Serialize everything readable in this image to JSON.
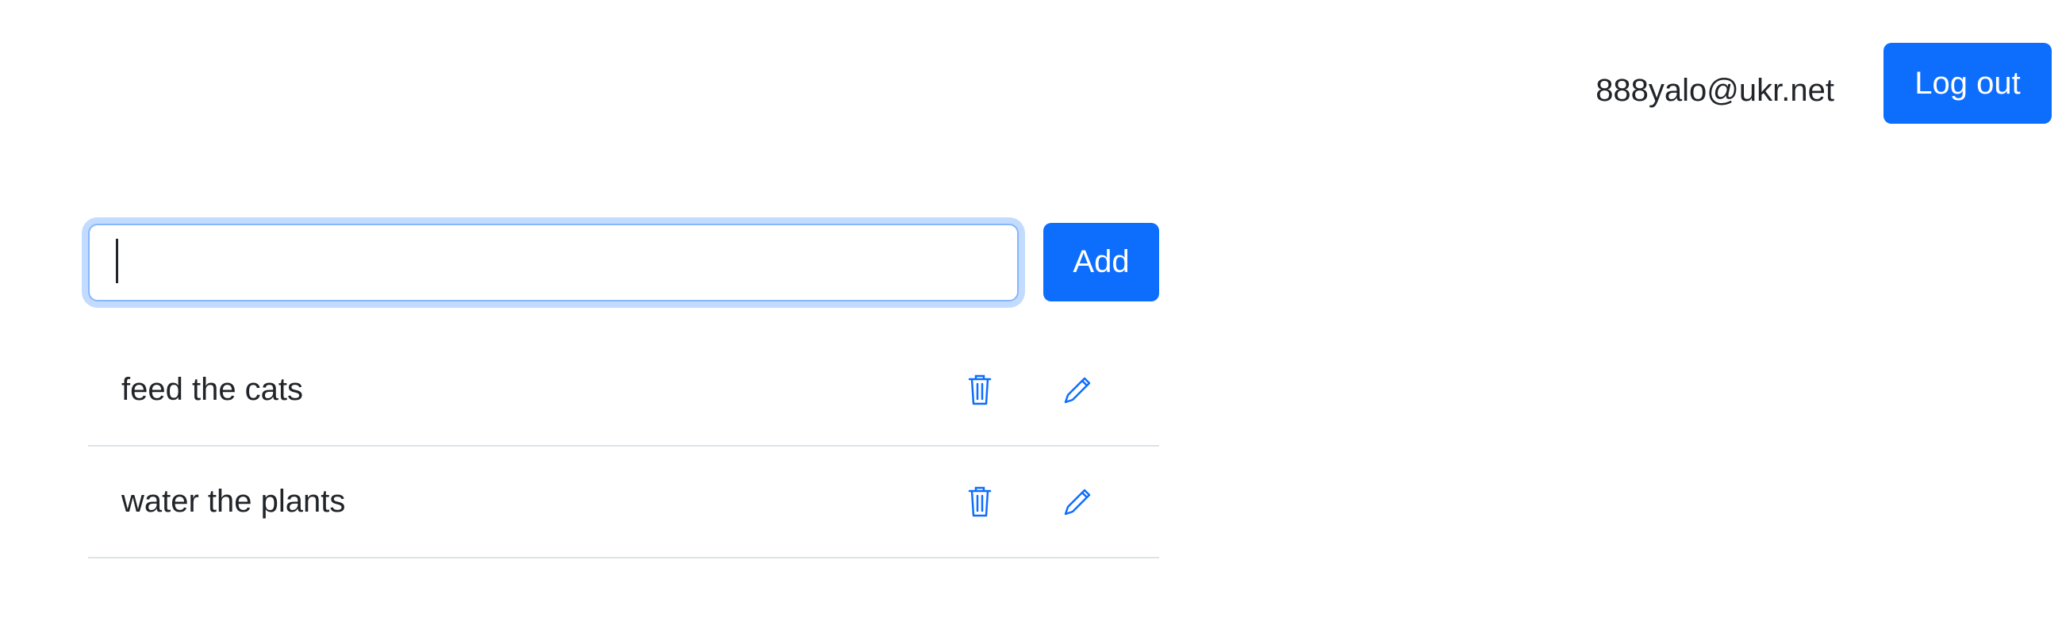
{
  "header": {
    "user_email": "888yalo@ukr.net",
    "logout_label": "Log out"
  },
  "new_todo": {
    "value": "",
    "placeholder": "",
    "add_label": "Add"
  },
  "todos": [
    {
      "text": "feed the cats",
      "delete_icon": "trash-icon",
      "edit_icon": "pencil-icon"
    },
    {
      "text": "water the plants",
      "delete_icon": "trash-icon",
      "edit_icon": "pencil-icon"
    }
  ],
  "colors": {
    "accent": "#0d6efd",
    "focus_ring": "#86b7fe",
    "divider": "#dee2e6",
    "text": "#212529"
  }
}
